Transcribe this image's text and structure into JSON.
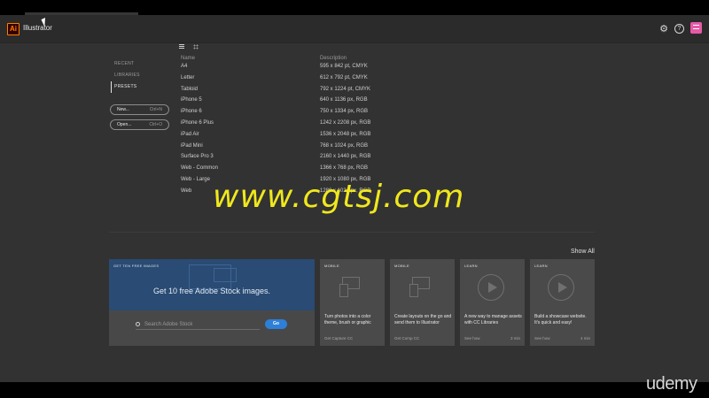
{
  "app": {
    "logo_text": "Ai",
    "name": "Illustrator"
  },
  "header_icons": [
    "gear-icon",
    "help-icon",
    "profile-menu-icon"
  ],
  "help_glyph": "?",
  "nav": {
    "items": [
      {
        "label": "RECENT"
      },
      {
        "label": "LIBRARIES"
      },
      {
        "label": "PRESETS"
      }
    ],
    "active": "PRESETS"
  },
  "buttons": {
    "new": {
      "label": "New...",
      "shortcut": "Ctrl+N"
    },
    "open": {
      "label": "Open...",
      "shortcut": "Ctrl+O"
    }
  },
  "table": {
    "columns": [
      "Name",
      "Description"
    ],
    "rows": [
      {
        "name": "A4",
        "desc": "595 x 842 pt, CMYK"
      },
      {
        "name": "Letter",
        "desc": "612 x 792 pt, CMYK"
      },
      {
        "name": "Tabloid",
        "desc": "792 x 1224 pt, CMYK"
      },
      {
        "name": "iPhone 5",
        "desc": "640 x 1136 px, RGB"
      },
      {
        "name": "iPhone 6",
        "desc": "750 x 1334 px, RGB"
      },
      {
        "name": "iPhone 6 Plus",
        "desc": "1242 x 2208 px, RGB"
      },
      {
        "name": "iPad Air",
        "desc": "1536 x 2048 px, RGB"
      },
      {
        "name": "iPad Mini",
        "desc": "768 x 1024 px, RGB"
      },
      {
        "name": "Surface Pro 3",
        "desc": "2160 x 1440 px, RGB"
      },
      {
        "name": "Web - Common",
        "desc": "1366 x 768 px, RGB"
      },
      {
        "name": "Web - Large",
        "desc": "1920 x 1080 px, RGB"
      },
      {
        "name": "Web",
        "desc": "1280 x 1024 px, RGB"
      }
    ]
  },
  "watermark": "www.cgtsj.com",
  "show_all": "Show All",
  "stock_card": {
    "tag": "GET TEN FREE IMAGES",
    "headline": "Get 10 free Adobe Stock images.",
    "search_placeholder": "Search Adobe Stock",
    "go_label": "Go"
  },
  "cards": [
    {
      "tag": "MOBILE",
      "text": "Turn photos into a color theme, brush or graphic",
      "footer": "Get Capture CC",
      "duration": "",
      "art": "devices"
    },
    {
      "tag": "MOBILE",
      "text": "Create layouts on the go and send them to Illustrator",
      "footer": "Get Comp CC",
      "duration": "",
      "art": "devices"
    },
    {
      "tag": "LEARN",
      "text": "A new way to manage assets with CC Libraries",
      "footer": "See how",
      "duration": "3 min",
      "art": "play"
    },
    {
      "tag": "LEARN",
      "text": "Build a showcase website. It's quick and easy!",
      "footer": "See how",
      "duration": "4 min",
      "art": "play"
    }
  ],
  "brand_overlay": "udemy",
  "colors": {
    "accent": "#ff7c00",
    "stock_blue": "#294b74",
    "go_button": "#2d7fd8",
    "profile": "#e85aa6",
    "watermark": "#f0e81c"
  }
}
